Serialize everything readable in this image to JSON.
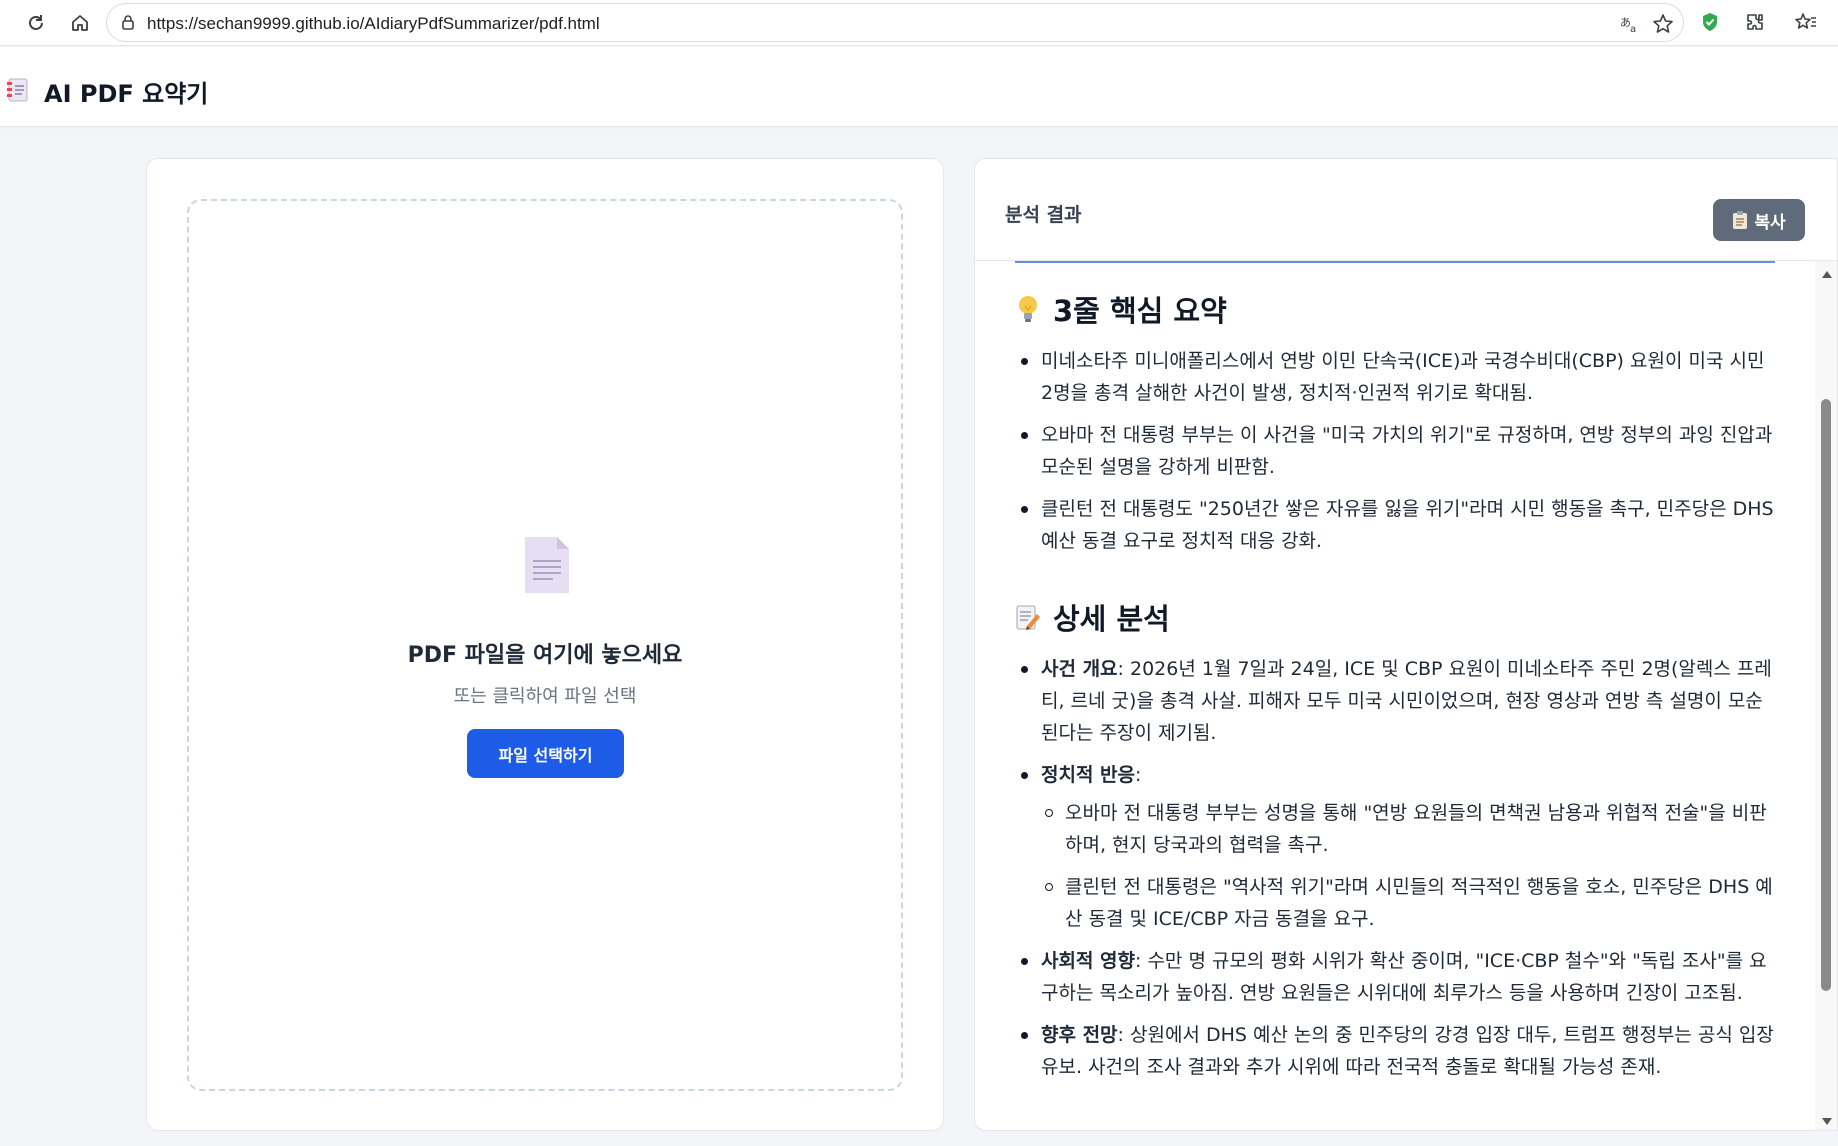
{
  "browser": {
    "url": "https://sechan9999.github.io/AIdiaryPdfSummarizer/pdf.html"
  },
  "header": {
    "title": "AI PDF 요약기"
  },
  "upload": {
    "drop_title": "PDF 파일을 여기에 놓으세요",
    "drop_subtitle": "또는 클릭하여 파일 선택",
    "button_label": "파일 선택하기"
  },
  "result": {
    "title": "분석 결과",
    "copy_label": "복사",
    "summary": {
      "heading": "3줄 핵심 요약",
      "items": [
        "미네소타주 미니애폴리스에서 연방 이민 단속국(ICE)과 국경수비대(CBP) 요원이 미국 시민 2명을 총격 살해한 사건이 발생, 정치적·인권적 위기로 확대됨.",
        "오바마 전 대통령 부부는 이 사건을 \"미국 가치의 위기\"로 규정하며, 연방 정부의 과잉 진압과 모순된 설명을 강하게 비판함.",
        "클린턴 전 대통령도 \"250년간 쌓은 자유를 잃을 위기\"라며 시민 행동을 촉구, 민주당은 DHS 예산 동결 요구로 정치적 대응 강화."
      ]
    },
    "detail": {
      "heading": "상세 분석",
      "overview_label": "사건 개요",
      "overview_text": ": 2026년 1월 7일과 24일, ICE 및 CBP 요원이 미네소타주 주민 2명(알렉스 프레티, 르네 굿)을 총격 사살. 피해자 모두 미국 시민이었으며, 현장 영상과 연방 측 설명이 모순된다는 주장이 제기됨.",
      "politics_label": "정치적 반응",
      "politics_colon": ":",
      "politics_sub": [
        "오바마 전 대통령 부부는 성명을 통해 \"연방 요원들의 면책권 남용과 위협적 전술\"을 비판하며, 현지 당국과의 협력을 촉구.",
        "클린턴 전 대통령은 \"역사적 위기\"라며 시민들의 적극적인 행동을 호소, 민주당은 DHS 예산 동결 및 ICE/CBP 자금 동결을 요구."
      ],
      "social_label": "사회적 영향",
      "social_text": ": 수만 명 규모의 평화 시위가 확산 중이며, \"ICE·CBP 철수\"와 \"독립 조사\"를 요구하는 목소리가 높아짐. 연방 요원들은 시위대에 최루가스 등을 사용하며 긴장이 고조됨.",
      "outlook_label": "향후 전망",
      "outlook_text": ": 상원에서 DHS 예산 논의 중 민주당의 강경 입장 대두, 트럼프 행정부는 공식 입장 유보. 사건의 조사 결과와 추가 시위에 따라 전국적 충돌로 확대될 가능성 존재."
    }
  },
  "colors": {
    "primary": "#1d5ce6",
    "copy_button": "#5f6b7a",
    "accent_line": "#6b8ed9"
  }
}
